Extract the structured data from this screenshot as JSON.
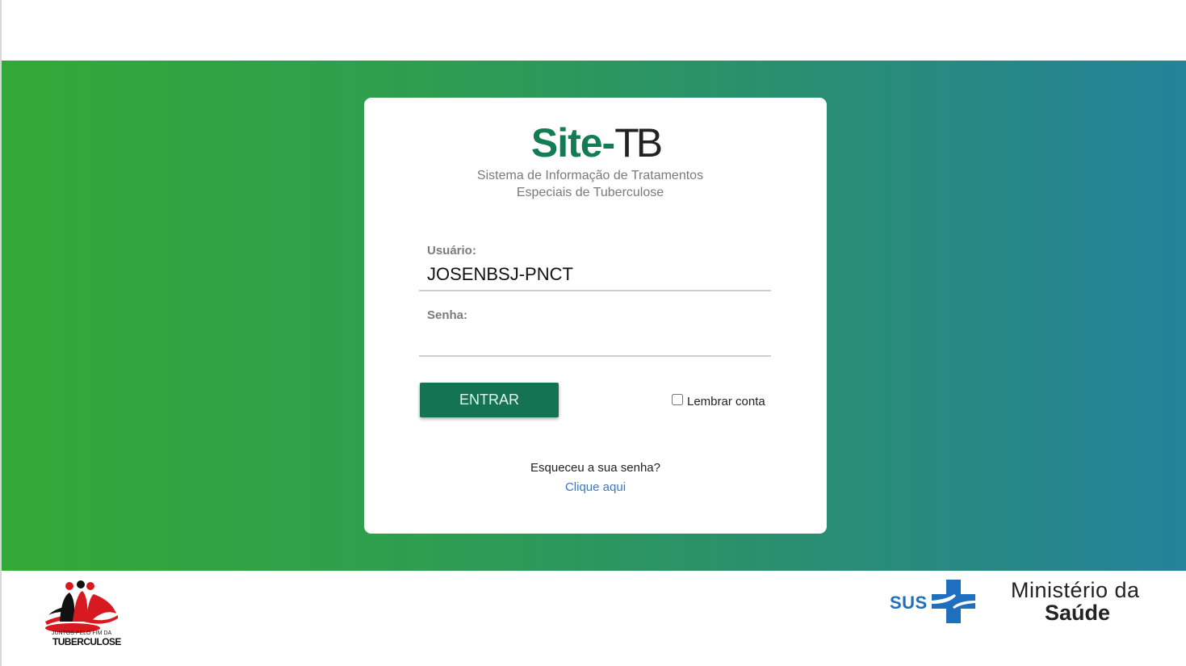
{
  "app": {
    "brand_left": "Site-",
    "brand_right": "TB",
    "subtitle_line1": "Sistema de Informação de Tratamentos",
    "subtitle_line2": "Especiais de Tuberculose"
  },
  "login": {
    "username_label": "Usuário:",
    "username_value": "JOSENBSJ-PNCT",
    "password_label": "Senha:",
    "password_value": "",
    "submit_label": "ENTRAR",
    "remember_label": "Lembrar conta",
    "remember_checked": false,
    "forgot_text": "Esqueceu a sua senha?",
    "forgot_link": "Clique aqui"
  },
  "footer": {
    "tb_logo_small": "JUNTOS PELO FIM DA",
    "tb_logo_big": "TUBERCULOSE",
    "sus_text": "SUS",
    "ministry_line1": "Ministério da",
    "ministry_line2": "Saúde"
  },
  "colors": {
    "gradient_start": "#32a937",
    "gradient_end": "#24829a",
    "button": "#137352",
    "brand_green": "#137c53",
    "link": "#3a78c7",
    "sus_blue": "#1f6fc1"
  }
}
